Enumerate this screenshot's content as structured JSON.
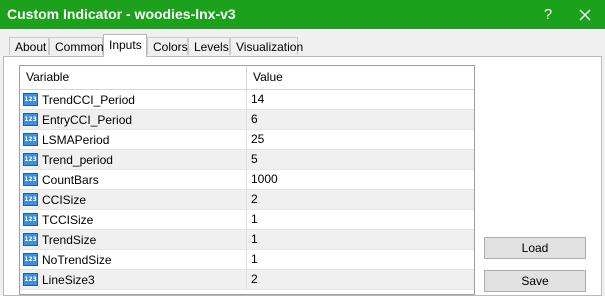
{
  "window": {
    "title": "Custom Indicator - woodies-lnx-v3",
    "help_label": "?",
    "close_label": "close"
  },
  "tabs": [
    "About",
    "Common",
    "Inputs",
    "Colors",
    "Levels",
    "Visualization"
  ],
  "active_tab": "Inputs",
  "grid": {
    "columns": [
      "Variable",
      "Value"
    ],
    "icon_text": "123",
    "rows": [
      {
        "name": "TrendCCI_Period",
        "value": "14"
      },
      {
        "name": "EntryCCI_Period",
        "value": "6"
      },
      {
        "name": "LSMAPeriod",
        "value": "25"
      },
      {
        "name": "Trend_period",
        "value": "5"
      },
      {
        "name": "CountBars",
        "value": "1000"
      },
      {
        "name": "CCISize",
        "value": "2"
      },
      {
        "name": "TCCISize",
        "value": "1"
      },
      {
        "name": "TrendSize",
        "value": "1"
      },
      {
        "name": "NoTrendSize",
        "value": "1"
      },
      {
        "name": "LineSize3",
        "value": "2"
      }
    ]
  },
  "buttons": {
    "load": "Load",
    "save": "Save"
  }
}
